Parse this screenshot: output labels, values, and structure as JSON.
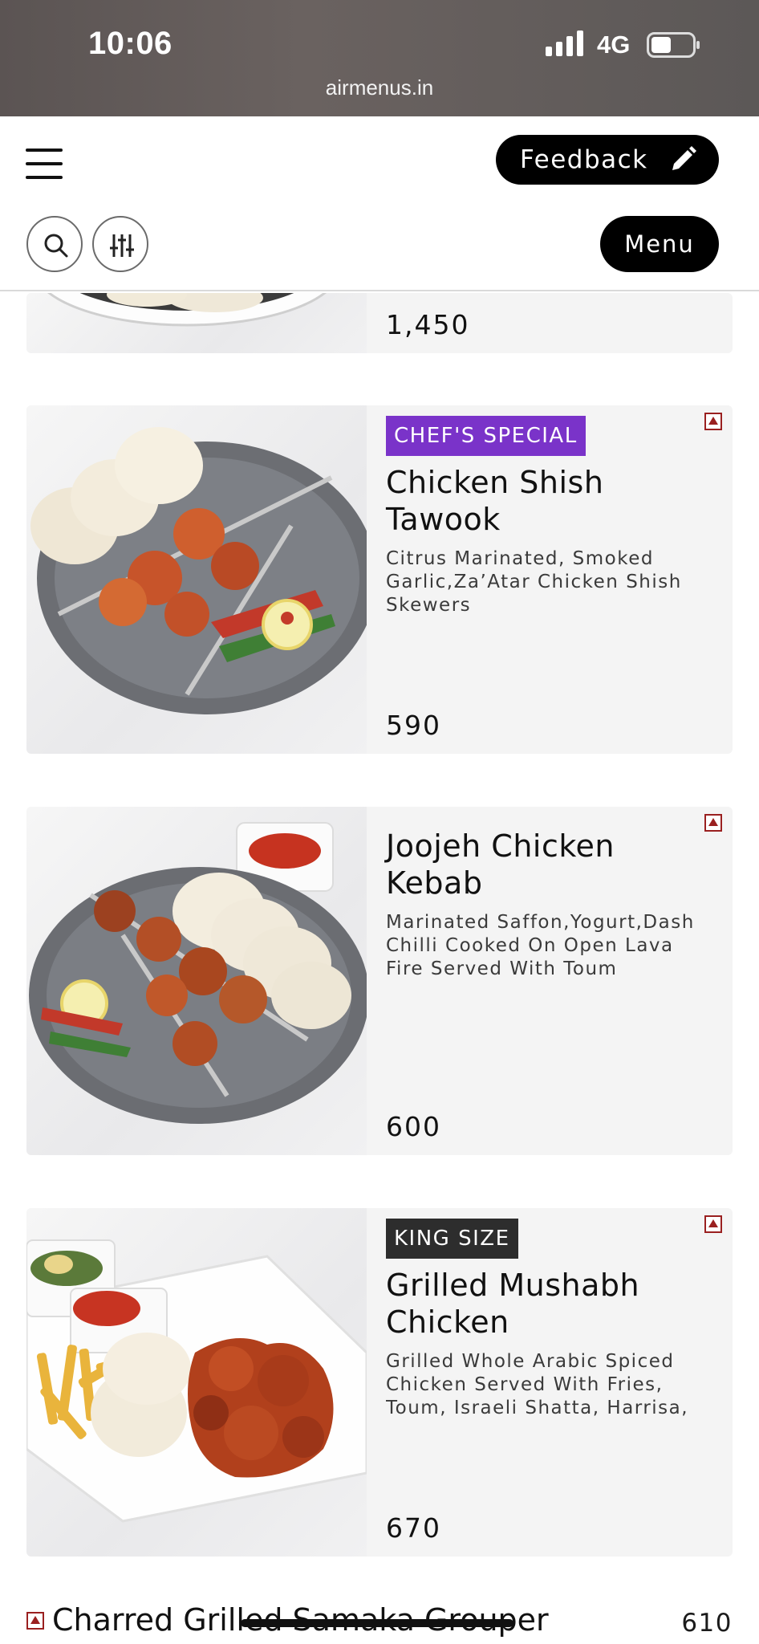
{
  "status_bar": {
    "time": "10:06",
    "network": "4G",
    "url": "airmenus.in"
  },
  "header": {
    "feedback_label": "Feedback",
    "menu_label": "Menu"
  },
  "items": [
    {
      "price": "1,450"
    },
    {
      "badge": "CHEF'S SPECIAL",
      "title": "Chicken Shish Tawook",
      "description": "Citrus Marinated, Smoked Garlic,Za’Atar Chicken Shish Skewers",
      "price": "590"
    },
    {
      "title": "Joojeh Chicken Kebab",
      "description": "Marinated Saffon,Yogurt,Dash Chilli Cooked On Open Lava Fire Served With Toum",
      "price": "600"
    },
    {
      "badge": "KING SIZE",
      "title": "Grilled Mushabh Chicken",
      "description": "Grilled Whole Arabic Spiced Chicken Served With Fries, Toum, Israeli Shatta, Harrisa, ...",
      "price": "670"
    },
    {
      "title": "Charred Grilled Samaka Grouper",
      "price": "610"
    }
  ],
  "colors": {
    "chef_badge": "#7a33c9",
    "king_badge": "#2d2d2d",
    "nonveg_marker": "#9a2020"
  }
}
